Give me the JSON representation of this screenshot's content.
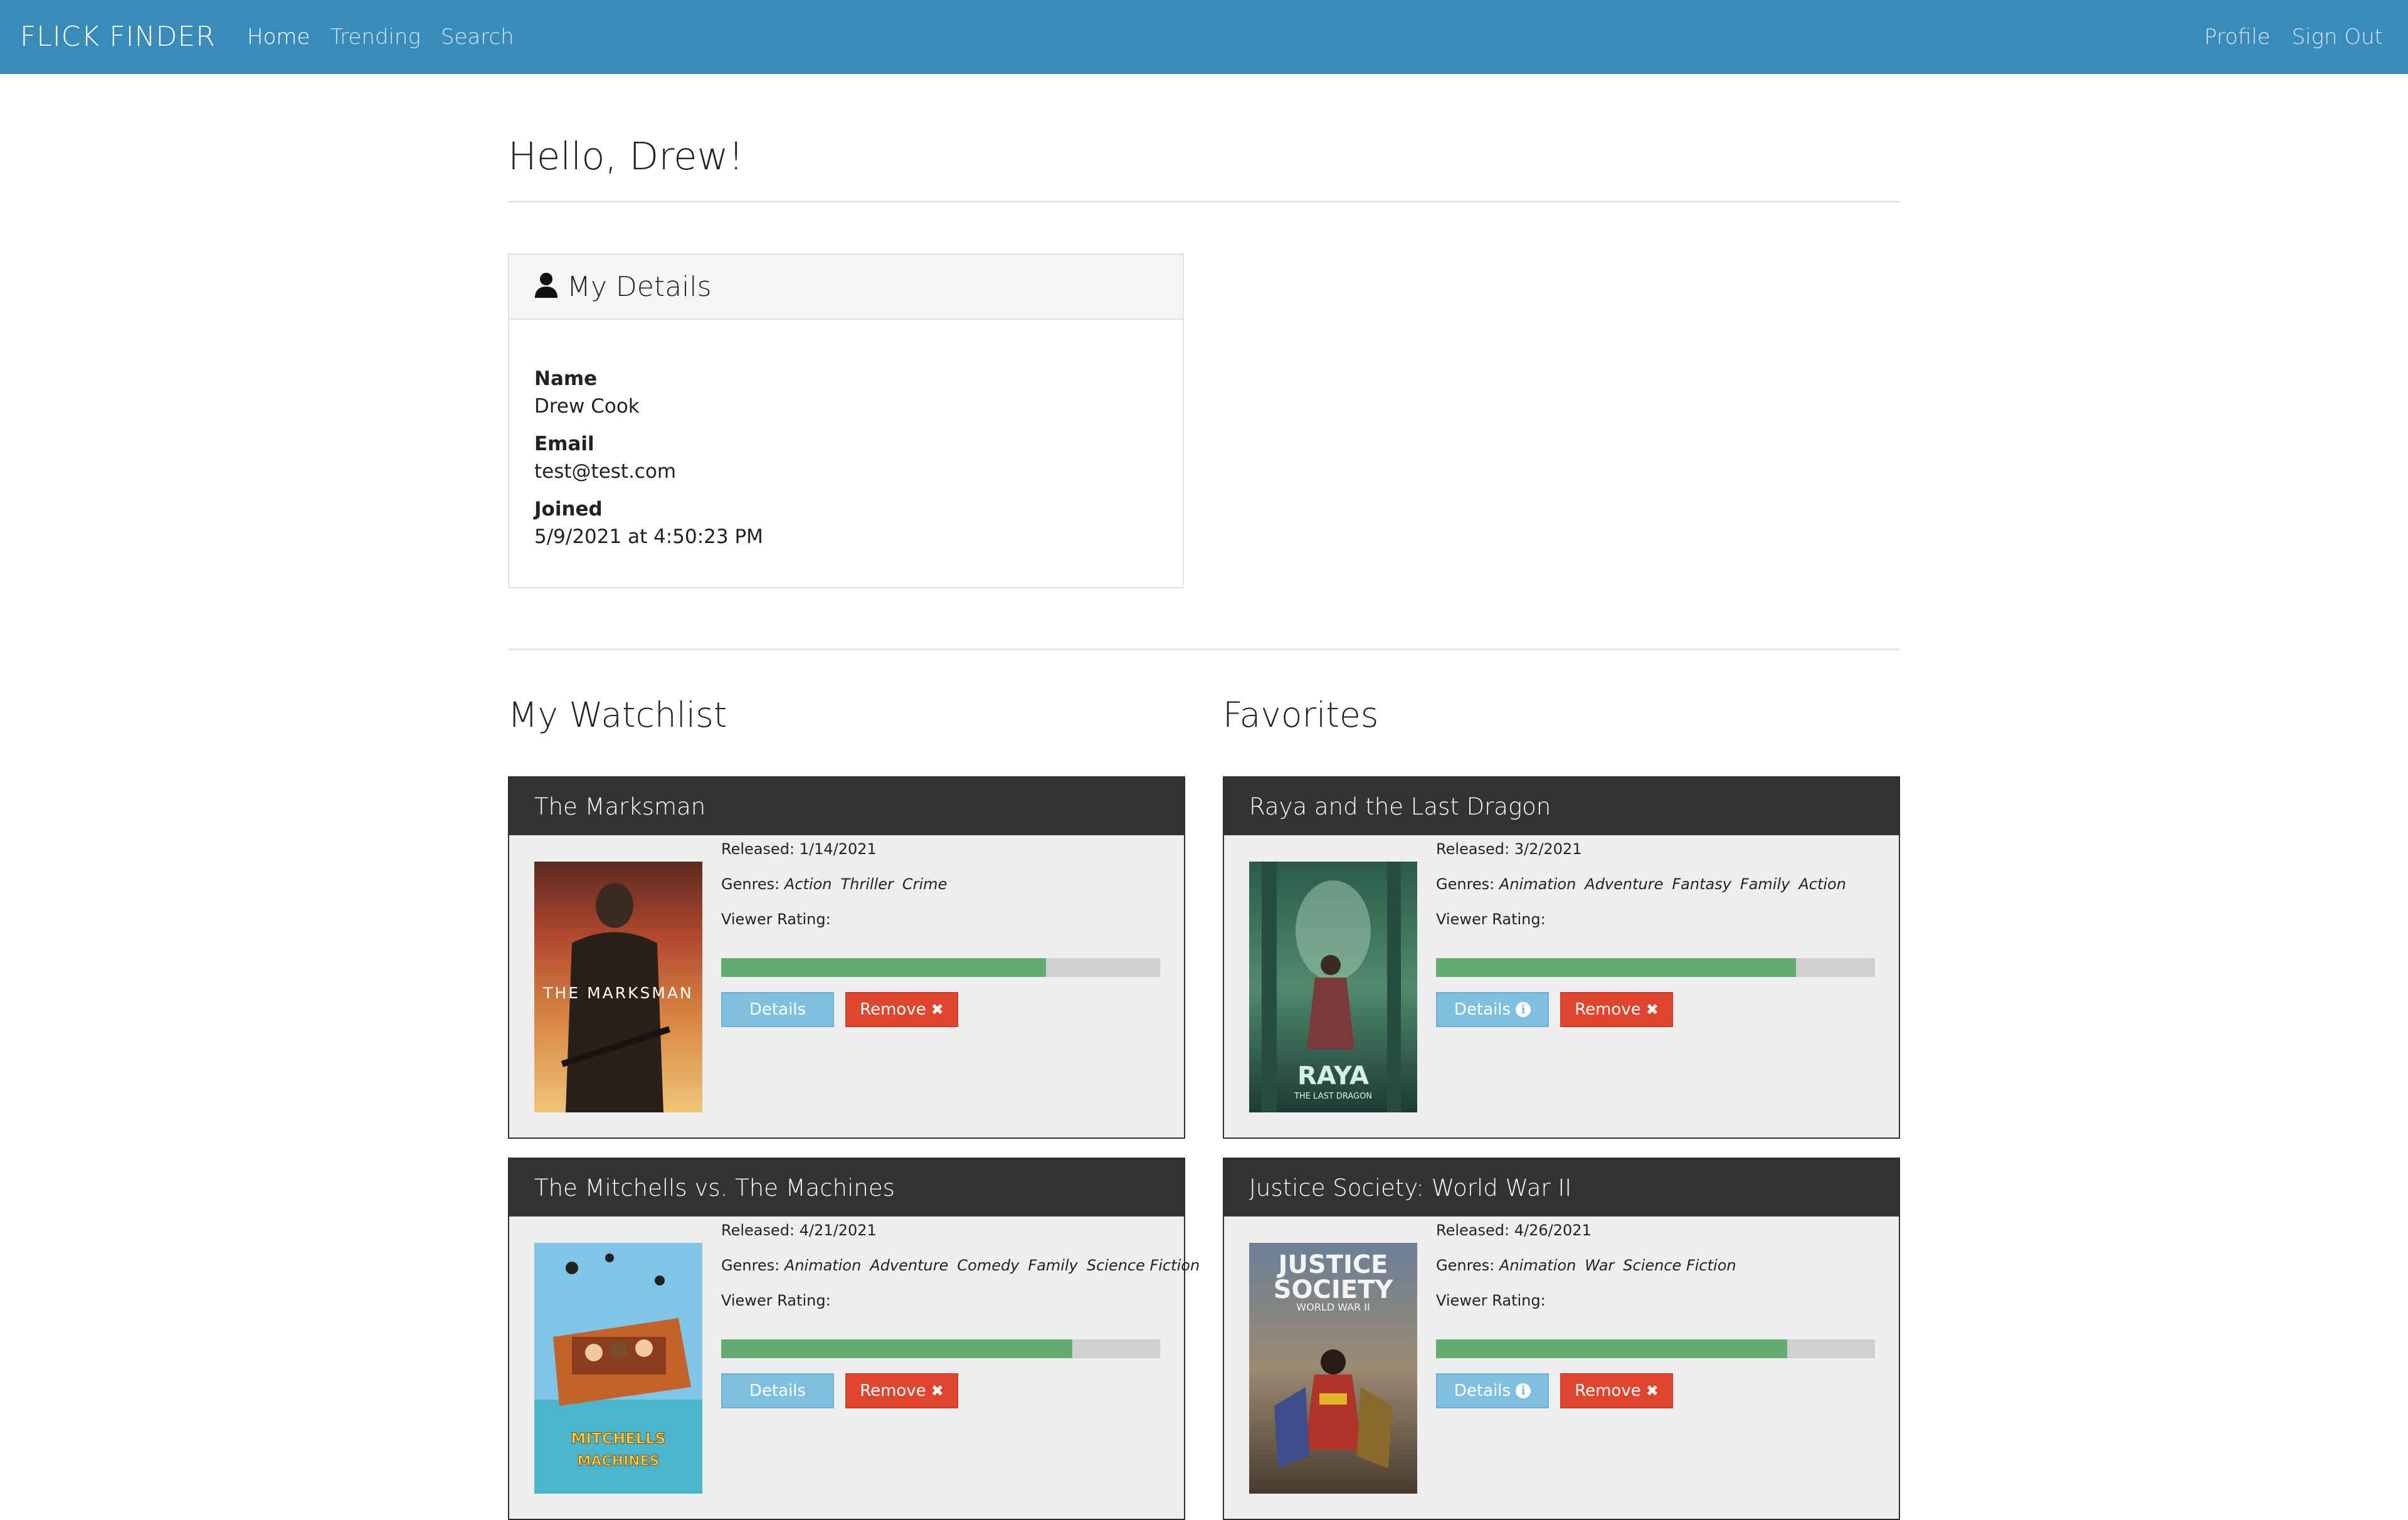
{
  "nav": {
    "brand": "FLICK FINDER",
    "left": [
      "Home",
      "Trending",
      "Search"
    ],
    "right": [
      "Profile",
      "Sign Out"
    ]
  },
  "greeting": "Hello, Drew!",
  "details": {
    "title": "My Details",
    "icon": "user-icon",
    "name_label": "Name",
    "name": "Drew Cook",
    "email_label": "Email",
    "email": "test@test.com",
    "joined_label": "Joined",
    "joined": "5/9/2021 at 4:50:23 PM"
  },
  "watchlist": {
    "title": "My Watchlist",
    "movies": [
      {
        "title": "The Marksman",
        "released": "Released: 1/14/2021",
        "genres_label": "Genres:",
        "genres": [
          "Action",
          "Thriller",
          "Crime"
        ],
        "rating_label": "Viewer Rating:",
        "rating": 0.74,
        "poster_text": "THE MARKSMAN",
        "details_label": "Details",
        "remove_label": "Remove"
      },
      {
        "title": "The Mitchells vs. The Machines",
        "released": "Released: 4/21/2021",
        "genres_label": "Genres:",
        "genres": [
          "Animation",
          "Adventure",
          "Comedy",
          "Family",
          "Science Fiction"
        ],
        "rating_label": "Viewer Rating:",
        "rating": 0.8,
        "poster_text": "MITCHELLS VS MACHINES",
        "details_label": "Details",
        "remove_label": "Remove"
      }
    ]
  },
  "favorites": {
    "title": "Favorites",
    "movies": [
      {
        "title": "Raya and the Last Dragon",
        "released": "Released: 3/2/2021",
        "genres_label": "Genres:",
        "genres": [
          "Animation",
          "Adventure",
          "Fantasy",
          "Family",
          "Action"
        ],
        "rating_label": "Viewer Rating:",
        "rating": 0.82,
        "poster_text": "RAYA",
        "poster_subtext": "THE LAST DRAGON",
        "details_label": "Details",
        "remove_label": "Remove"
      },
      {
        "title": "Justice Society: World War II",
        "released": "Released: 4/26/2021",
        "genres_label": "Genres:",
        "genres": [
          "Animation",
          "War",
          "Science Fiction"
        ],
        "rating_label": "Viewer Rating:",
        "rating": 0.8,
        "poster_text": "JUSTICE SOCIETY",
        "poster_subtext": "WORLD WAR II",
        "details_label": "Details",
        "remove_label": "Remove"
      }
    ]
  },
  "colors": {
    "navbar": "#3a8bba",
    "rating_fill": "#63ad72",
    "details_button": "#7fbfdf",
    "remove_button": "#e0462e",
    "card_header": "#333333"
  }
}
